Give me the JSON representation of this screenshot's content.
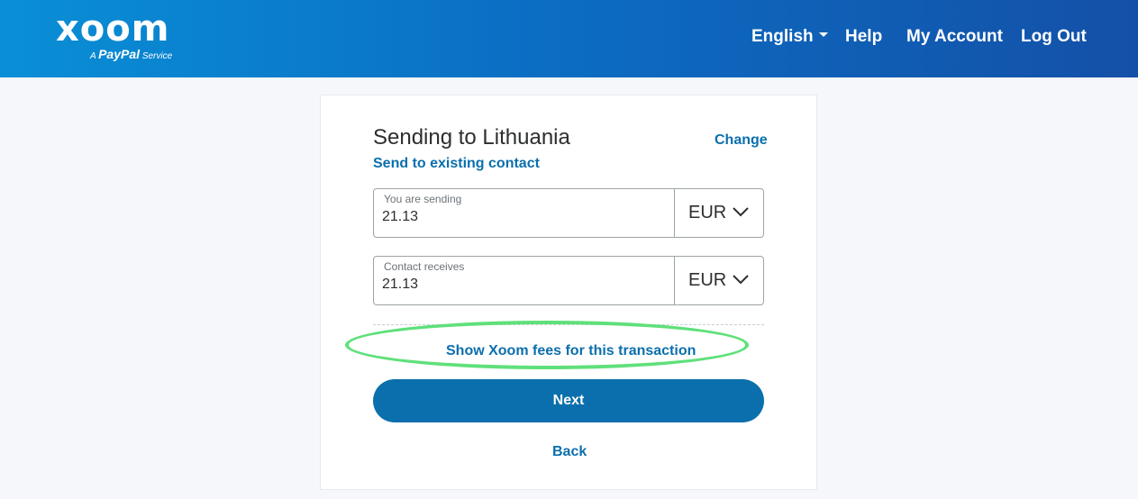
{
  "header": {
    "logo_text": "xoom",
    "logo_sub_prefix": "A",
    "logo_sub_brand": "PayPal",
    "logo_sub_suffix": "Service",
    "nav": {
      "language": "English",
      "help": "Help",
      "my_account": "My Account",
      "log_out": "Log Out"
    }
  },
  "card": {
    "title": "Sending to Lithuania",
    "change_link": "Change",
    "existing_contact_link": "Send to existing contact",
    "sending": {
      "label": "You are sending",
      "value": "21.13",
      "currency": "EUR"
    },
    "receives": {
      "label": "Contact receives",
      "value": "21.13",
      "currency": "EUR"
    },
    "fees_link": "Show Xoom fees for this transaction",
    "next_button": "Next",
    "back_link": "Back"
  },
  "colors": {
    "header_start": "#0a8fd6",
    "header_end": "#1450a8",
    "link": "#0b6fad",
    "button": "#0b6fad",
    "highlight": "#5fe07a"
  }
}
